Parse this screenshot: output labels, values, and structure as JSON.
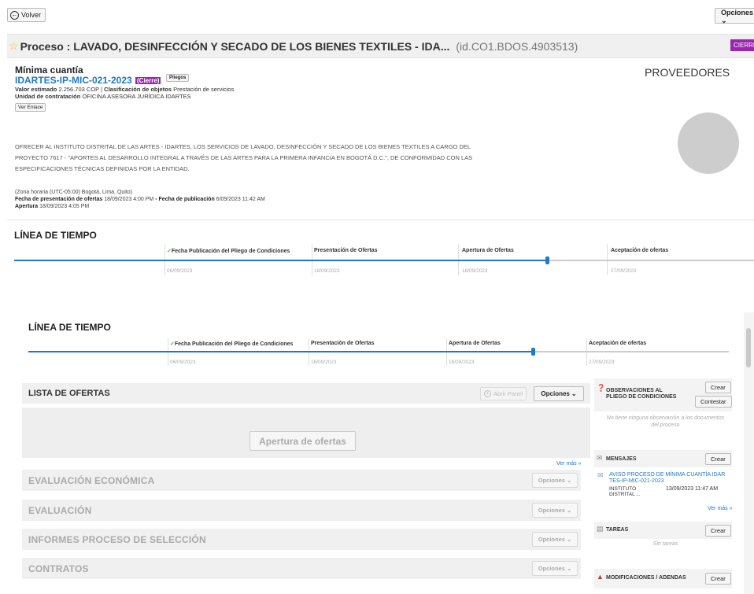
{
  "topbar": {
    "back_label": "Volver",
    "options_label": "Opciones"
  },
  "process": {
    "title": "Proceso : LAVADO, DESINFECCIÓN Y SECADO DE LOS BIENES TEXTILES - IDA...",
    "id": "(id.CO1.BDOS.4903513)",
    "status_badge": "CIERRE",
    "modality": "Mínima cuantía",
    "code": "IDARTES-IP-MIC-021-2023",
    "status_tag": "(Cierre)",
    "pliegos_label": "Pliegos",
    "valor_label": "Valor estimado",
    "valor": "2.256.703 COP",
    "clasificacion_label": "Clasificación de objetos",
    "clasificacion": "Prestación de servicios",
    "unidad_label": "Unidad de contratación",
    "unidad": "OFICINA ASESORA JURÍDICA IDARTES",
    "ver_enlace": "Ver Enlace",
    "proveedores": "PROVEEDORES",
    "description_1": "OFRECER AL INSTITUTO DISTRITAL DE LAS ARTES - IDARTES, LOS SERVICIOS DE LAVADO, DESINFECCIÓN Y SECADO DE LOS BIENES TEXTILES A CARGO DEL",
    "description_2": "PROYECTO 7617 - \"APORTES AL DESARROLLO INTEGRAL A TRAVÉS DE LAS ARTES PARA LA PRIMERA INFANCIA EN BOGOTÁ D.C.\", DE CONFORMIDAD CON LAS",
    "description_3": "ESPECIFICACIONES TÉCNICAS DEFINIDAS POR LA ENTIDAD.",
    "timezone": "(Zona horaria (UTC-05:00) Bogotá, Lima, Quito)",
    "presentacion_label": "Fecha de presentación de ofertas",
    "presentacion": "18/09/2023 4:00 PM",
    "separator": "-",
    "publicacion_label": "Fecha de publicación",
    "publicacion": "6/09/2023 11:42 AM",
    "apertura_label": "Apertura",
    "apertura": "18/09/2023 4:05 PM"
  },
  "timeline": {
    "title": "LÍNEA DE TIEMPO",
    "check": "✓",
    "steps": [
      {
        "label": "Fecha Publicación del Pliego de Condiciones",
        "date": "06/09/2023"
      },
      {
        "label": "Presentación de Ofertas",
        "date": "18/09/2023"
      },
      {
        "label": "Apertura de Ofertas",
        "date": "18/09/2023"
      },
      {
        "label": "Aceptación de ofertas",
        "date": "27/09/2023"
      }
    ],
    "progress": 0.72
  },
  "lower": {
    "ofertas_title": "LISTA DE OFERTAS",
    "abrir_panel": "Abrir Panel",
    "options_label": "Opciones",
    "apertura_btn": "Apertura de ofertas",
    "ver_mas": "Ver más »",
    "sections": [
      {
        "title": "EVALUACIÓN ECONÓMICA",
        "options": "Opciones"
      },
      {
        "title": "EVALUACIÓN",
        "options": "Opciones"
      },
      {
        "title": "INFORMES PROCESO DE SELECCIÓN",
        "options": "Opciones"
      },
      {
        "title": "CONTRATOS",
        "options": "Opciones"
      }
    ]
  },
  "sidebar": {
    "observaciones_title_1": "OBSERVACIONES AL",
    "observaciones_title_2": "PLIEGO DE CONDICIONES",
    "crear": "Crear",
    "contestar": "Contestar",
    "obs_empty_1": "No tiene ninguna observación a los documentos",
    "obs_empty_2": "del proceso",
    "mensajes_title": "MENSAJES",
    "mensaje_subject_1": "AVISO PROCESO DE MÍNIMA CUANTÍA IDAR",
    "mensaje_subject_2": "TES-IP-MIC-021-2023",
    "mensaje_from_1": "INSTITUTO",
    "mensaje_from_2": "DISTRITAL ...",
    "mensaje_date": "13/09/2023 11:47 AM",
    "ver_mas": "Ver más »",
    "tareas_title": "TAREAS",
    "tareas_empty": "Sin tareas",
    "modificaciones_title": "MODIFICACIONES / ADENDAS"
  }
}
